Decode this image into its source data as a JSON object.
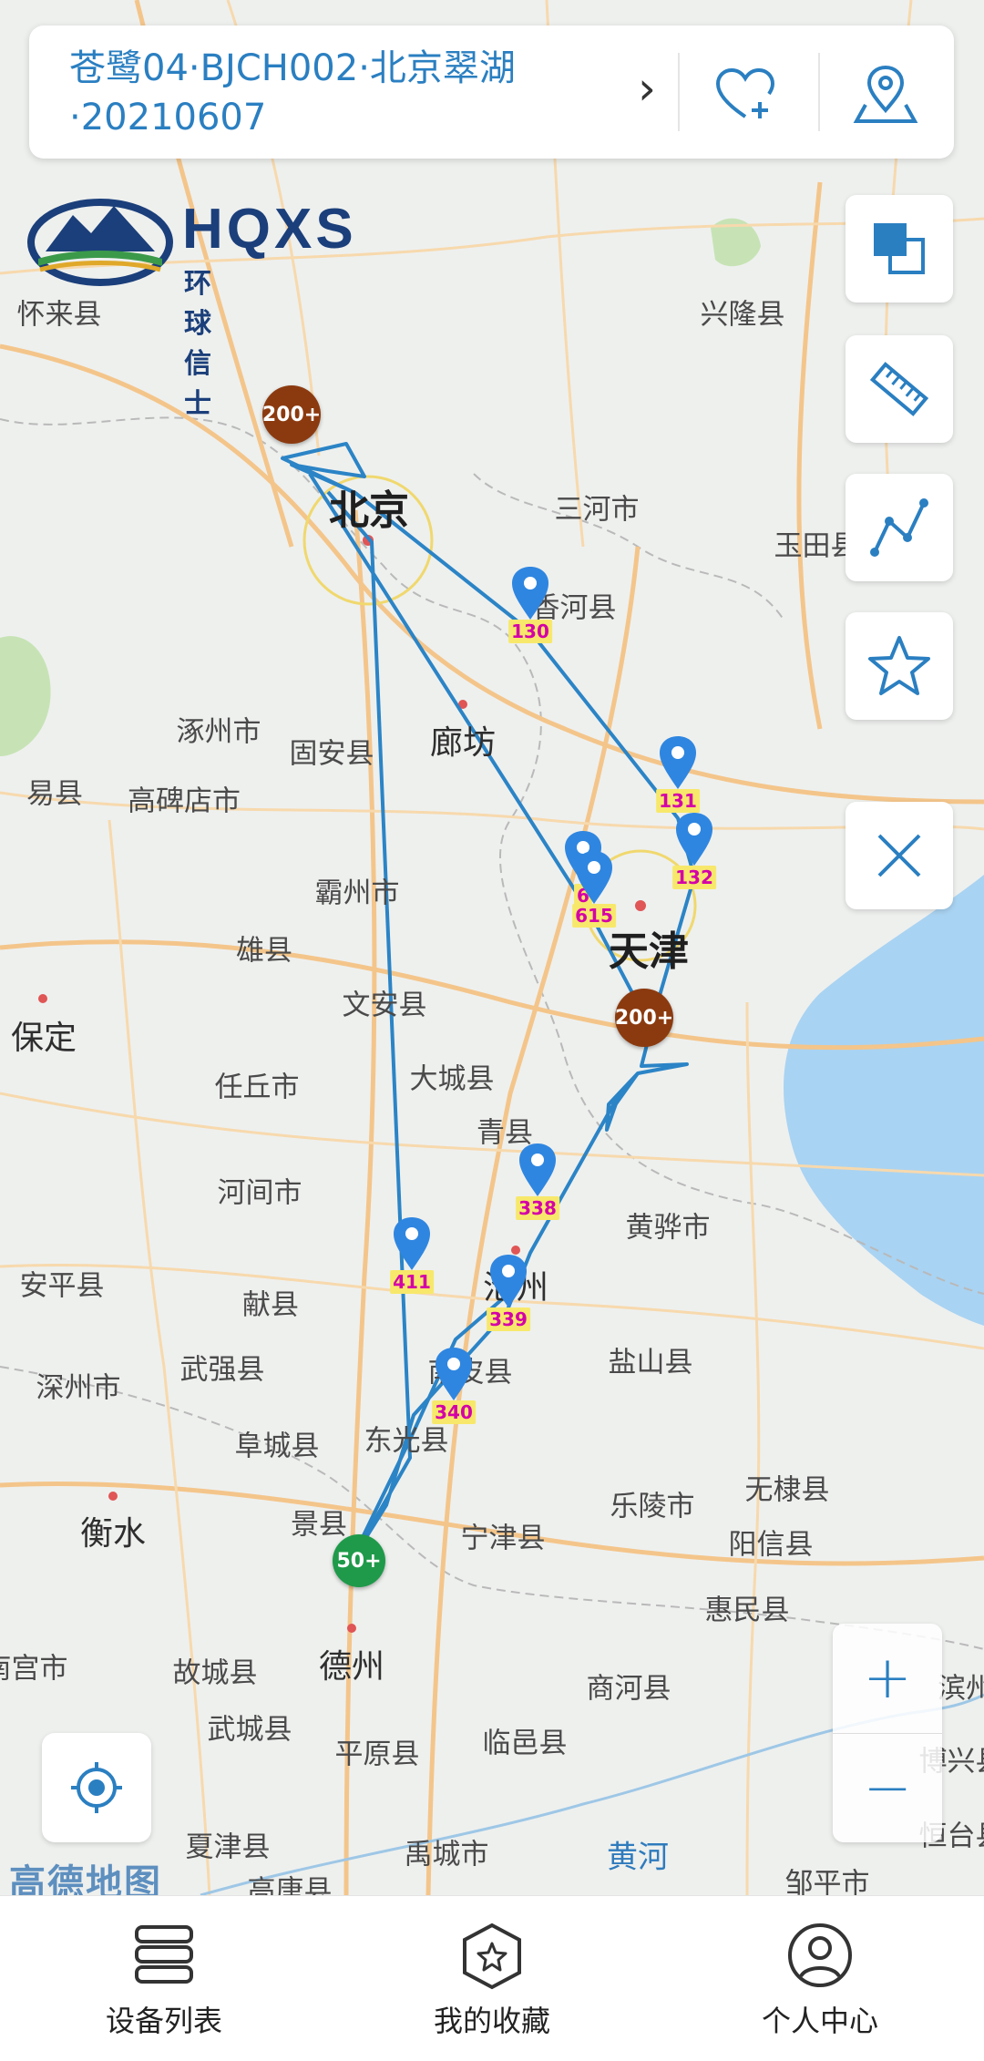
{
  "header": {
    "title": "苍鹭04·BJCH002·北京翠湖·20210607",
    "chevron_icon": "chevron-right-icon",
    "favorite_icon": "heart-plus-icon",
    "location_icon": "location-pin-icon"
  },
  "brand": {
    "name": "HQXS",
    "subtitle": "环球信士"
  },
  "side_tools": [
    {
      "name": "layers-button",
      "icon": "layers-icon"
    },
    {
      "name": "ruler-button",
      "icon": "ruler-icon"
    },
    {
      "name": "track-button",
      "icon": "track-line-icon"
    },
    {
      "name": "favorite-star-button",
      "icon": "star-icon"
    },
    {
      "name": "close-button",
      "icon": "close-icon"
    }
  ],
  "zoom": {
    "in": "+",
    "out": "−"
  },
  "attribution": "高德地图",
  "places": [
    {
      "t": "怀来县",
      "c": ""
    },
    {
      "t": "兴隆县",
      "c": ""
    },
    {
      "t": "北京",
      "c": "big"
    },
    {
      "t": "三河市",
      "c": ""
    },
    {
      "t": "玉田县",
      "c": ""
    },
    {
      "t": "香河县",
      "c": ""
    },
    {
      "t": "涿州市",
      "c": ""
    },
    {
      "t": "固安县",
      "c": ""
    },
    {
      "t": "廊坊",
      "c": "mid"
    },
    {
      "t": "易县",
      "c": ""
    },
    {
      "t": "高碑店市",
      "c": ""
    },
    {
      "t": "霸州市",
      "c": ""
    },
    {
      "t": "天津",
      "c": "big"
    },
    {
      "t": "雄县",
      "c": ""
    },
    {
      "t": "文安县",
      "c": ""
    },
    {
      "t": "保定",
      "c": "mid"
    },
    {
      "t": "任丘市",
      "c": ""
    },
    {
      "t": "大城县",
      "c": ""
    },
    {
      "t": "青县",
      "c": ""
    },
    {
      "t": "河间市",
      "c": ""
    },
    {
      "t": "黄骅市",
      "c": ""
    },
    {
      "t": "安平县",
      "c": ""
    },
    {
      "t": "献县",
      "c": ""
    },
    {
      "t": "沧州",
      "c": "mid"
    },
    {
      "t": "武强县",
      "c": ""
    },
    {
      "t": "南皮县",
      "c": ""
    },
    {
      "t": "盐山县",
      "c": ""
    },
    {
      "t": "深州市",
      "c": ""
    },
    {
      "t": "阜城县",
      "c": ""
    },
    {
      "t": "东光县",
      "c": ""
    },
    {
      "t": "无棣县",
      "c": ""
    },
    {
      "t": "衡水",
      "c": "mid"
    },
    {
      "t": "景县",
      "c": ""
    },
    {
      "t": "乐陵市",
      "c": ""
    },
    {
      "t": "宁津县",
      "c": ""
    },
    {
      "t": "阳信县",
      "c": ""
    },
    {
      "t": "惠民县",
      "c": ""
    },
    {
      "t": "故城县",
      "c": ""
    },
    {
      "t": "德州",
      "c": "mid"
    },
    {
      "t": "商河县",
      "c": ""
    },
    {
      "t": "武城县",
      "c": ""
    },
    {
      "t": "平原县",
      "c": ""
    },
    {
      "t": "临邑县",
      "c": ""
    },
    {
      "t": "夏津县",
      "c": ""
    },
    {
      "t": "禹城市",
      "c": ""
    },
    {
      "t": "黄河",
      "c": "water"
    },
    {
      "t": "邹平市",
      "c": ""
    },
    {
      "t": "高唐县",
      "c": ""
    },
    {
      "t": "南宫市",
      "c": ""
    },
    {
      "t": "恒台县",
      "c": ""
    },
    {
      "t": "博兴县",
      "c": ""
    },
    {
      "t": "滨州",
      "c": ""
    }
  ],
  "markers": [
    {
      "label": "130"
    },
    {
      "label": "131"
    },
    {
      "label": "132"
    },
    {
      "label": "6"
    },
    {
      "label": "615"
    },
    {
      "label": "338"
    },
    {
      "label": "411"
    },
    {
      "label": "339"
    },
    {
      "label": "340"
    }
  ],
  "clusters": [
    {
      "label": "200+",
      "color": "#8b3a0f"
    },
    {
      "label": "200+",
      "color": "#8b3a0f"
    },
    {
      "label": "50+",
      "color": "#1f9a4a"
    }
  ],
  "colors": {
    "track": "#2b84c6",
    "accent": "#2a7fc1",
    "pin": "#2f86e0"
  },
  "bottom_nav": [
    {
      "label": "设备列表",
      "icon": "device-list-icon"
    },
    {
      "label": "我的收藏",
      "icon": "favorites-star-icon"
    },
    {
      "label": "个人中心",
      "icon": "user-center-icon"
    }
  ]
}
